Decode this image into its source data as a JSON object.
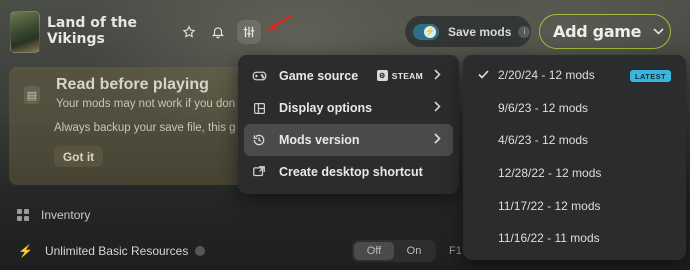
{
  "header": {
    "game_title": "Land of the\nVikings",
    "save_mods_label": "Save mods",
    "add_game_label": "Add game"
  },
  "notice": {
    "title": "Read before playing",
    "line1": "Your mods may not work if you don",
    "line2": "Always backup your save file, this g",
    "button": "Got it"
  },
  "menu": {
    "items": [
      {
        "label": "Game source",
        "badge": "STEAM",
        "icon": "gamepad-icon"
      },
      {
        "label": "Display options",
        "icon": "layout-icon"
      },
      {
        "label": "Mods version",
        "icon": "history-icon"
      },
      {
        "label": "Create desktop shortcut",
        "icon": "shortcut-icon"
      }
    ]
  },
  "versions": {
    "items": [
      {
        "label": "2/20/24 - 12 mods",
        "selected": true,
        "badge": "LATEST"
      },
      {
        "label": "9/6/23 - 12 mods"
      },
      {
        "label": "4/6/23 - 12 mods"
      },
      {
        "label": "12/28/22 - 12 mods"
      },
      {
        "label": "11/17/22 - 12 mods"
      },
      {
        "label": "11/16/22 - 11 mods"
      }
    ]
  },
  "list": {
    "inventory_label": "Inventory",
    "resources_label": "Unlimited Basic Resources",
    "toggle_off": "Off",
    "toggle_on": "On",
    "hotkey": "F1"
  },
  "colors": {
    "accent_green": "#9fbf3c",
    "badge_blue": "#38b6e0",
    "annotation_red": "#e0231c"
  }
}
